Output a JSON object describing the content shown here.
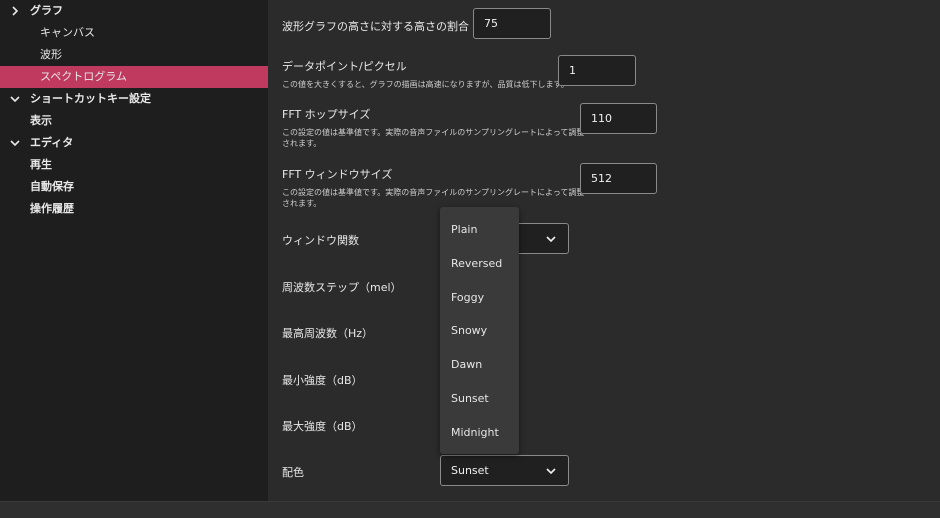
{
  "sidebar": {
    "graph_label": "グラフ",
    "canvas_label": "キャンバス",
    "waveform_label": "波形",
    "spectrogram_label": "スペクトログラム",
    "shortcut_label": "ショートカットキー設定",
    "display_label": "表示",
    "editor_label": "エディタ",
    "playback_label": "再生",
    "autosave_label": "自動保存",
    "history_label": "操作履歴"
  },
  "settings": {
    "height_ratio": {
      "label": "波形グラフの高さに対する高さの割合（%）",
      "value": "75"
    },
    "points_per_pixel": {
      "label": "データポイント/ピクセル",
      "description": "この値を大きくすると、グラフの描画は高速になりますが、品質は低下します。",
      "value": "1"
    },
    "fft_hop": {
      "label": "FFT ホップサイズ",
      "description_line1": "この設定の値は基準値です。実際の音声ファイルのサンプリングレートによって調整",
      "description_line2": "されます。",
      "value": "110"
    },
    "fft_window_size": {
      "label": "FFT ウィンドウサイズ",
      "description_line1": "この設定の値は基準値です。実際の音声ファイルのサンプリングレートによって調整",
      "description_line2": "されます。",
      "value": "512"
    },
    "window_function": {
      "label": "ウィンドウ関数"
    },
    "freq_step": {
      "label": "周波数ステップ（mel）"
    },
    "max_freq": {
      "label": "最高周波数（Hz）"
    },
    "min_intensity": {
      "label": "最小強度（dB）"
    },
    "max_intensity": {
      "label": "最大強度（dB）"
    },
    "color_scheme": {
      "label": "配色",
      "value": "Sunset"
    }
  },
  "color_menu": {
    "options": [
      "Plain",
      "Reversed",
      "Foggy",
      "Snowy",
      "Dawn",
      "Sunset",
      "Midnight"
    ]
  },
  "colors": {
    "accent": "#c0395f",
    "sidebar_bg": "#1e1e1e",
    "content_bg": "#2b2b2b"
  },
  "icons": {
    "expand": "chevron-down-icon",
    "collapse": "chevron-right-icon"
  }
}
